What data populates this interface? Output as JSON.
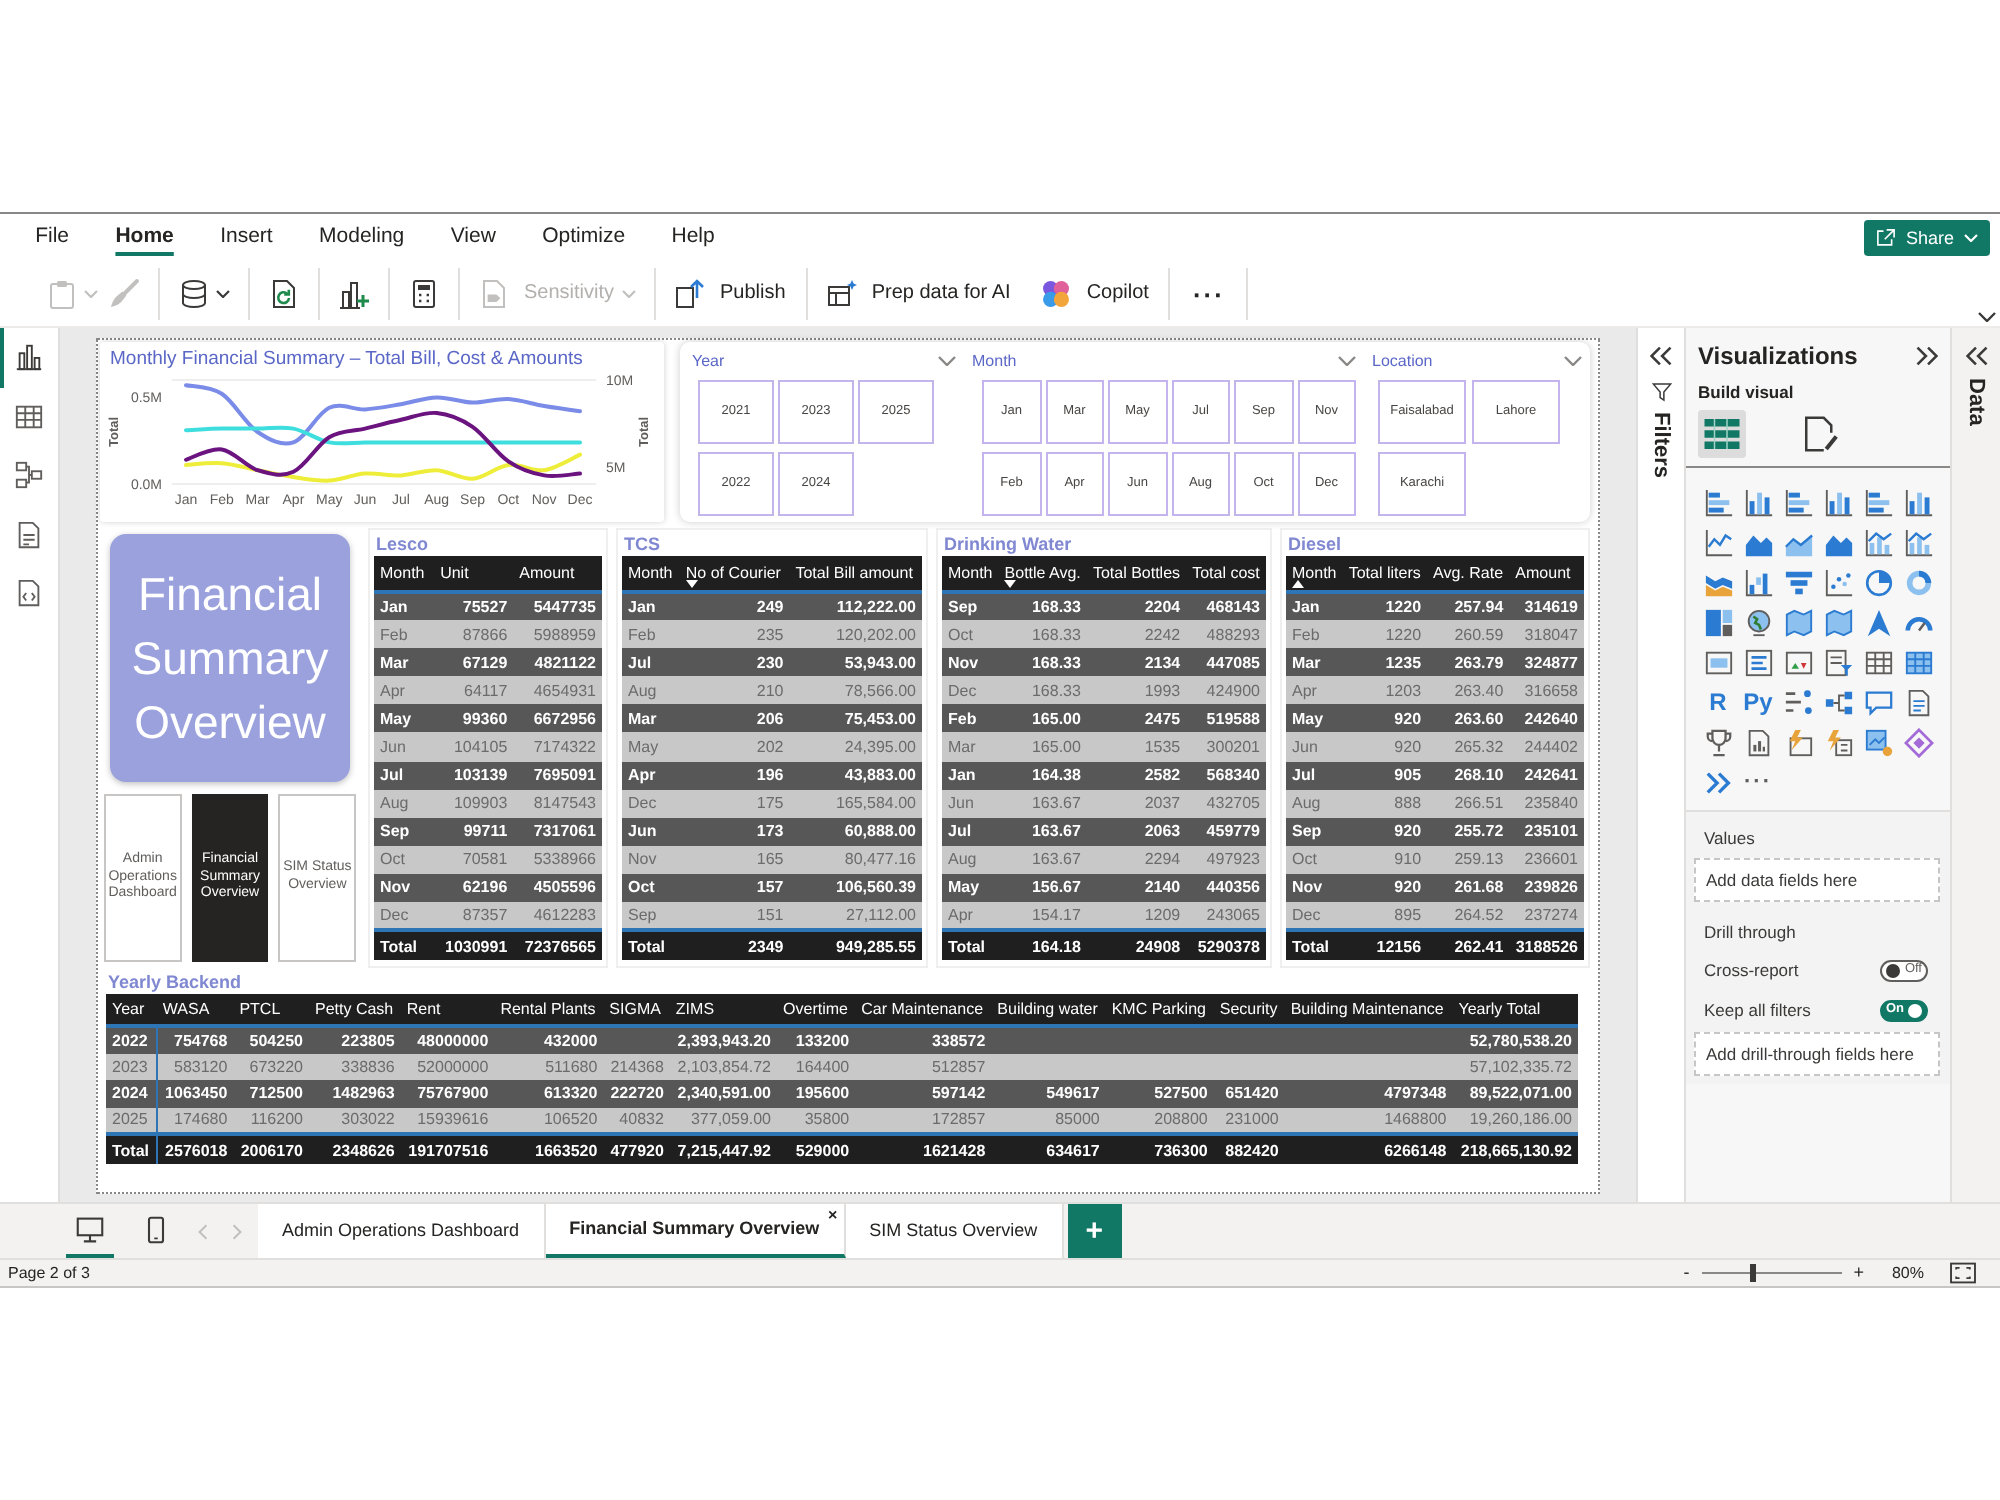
{
  "menu": {
    "tabs": [
      {
        "label": "File",
        "selected": false
      },
      {
        "label": "Home",
        "selected": true
      },
      {
        "label": "Insert",
        "selected": false
      },
      {
        "label": "Modeling",
        "selected": false
      },
      {
        "label": "View",
        "selected": false
      },
      {
        "label": "Optimize",
        "selected": false
      },
      {
        "label": "Help",
        "selected": false
      }
    ],
    "share": {
      "label": "Share"
    }
  },
  "ribbon": {
    "groups": [
      [
        {
          "kind": "paste",
          "disabled": true,
          "dropdown": true
        },
        {
          "kind": "format_painter",
          "disabled": true,
          "dropdown": false
        }
      ],
      [
        {
          "kind": "get_data",
          "disabled": false,
          "dropdown": true
        }
      ],
      [
        {
          "kind": "refresh",
          "disabled": false,
          "dropdown": false
        }
      ],
      [
        {
          "kind": "new_visual",
          "disabled": false,
          "dropdown": false
        }
      ],
      [
        {
          "kind": "calculator",
          "disabled": false,
          "dropdown": false
        }
      ],
      [
        {
          "kind": "sensitivity",
          "label": "Sensitivity",
          "disabled": true,
          "dropdown": true
        }
      ],
      [
        {
          "kind": "publish",
          "label": "Publish",
          "disabled": false,
          "dropdown": false
        }
      ],
      [
        {
          "kind": "prep_ai",
          "label": "Prep data for AI",
          "disabled": false,
          "dropdown": false
        },
        {
          "kind": "copilot",
          "label": "Copilot",
          "disabled": false,
          "dropdown": false
        }
      ],
      [
        {
          "kind": "more",
          "label": "···",
          "disabled": false,
          "dropdown": false
        }
      ]
    ]
  },
  "view_nav": [
    {
      "kind": "report",
      "selected": true
    },
    {
      "kind": "table",
      "selected": false
    },
    {
      "kind": "model",
      "selected": false
    },
    {
      "kind": "dax",
      "selected": false
    },
    {
      "kind": "tmdl",
      "selected": false
    }
  ],
  "report": {
    "chart": {
      "title": "Monthly Financial Summary – Total Bill, Cost & Amounts",
      "chart_data": {
        "type": "line",
        "categories": [
          "Jan",
          "Feb",
          "Mar",
          "Apr",
          "May",
          "Jun",
          "Jul",
          "Aug",
          "Sep",
          "Oct",
          "Nov",
          "Dec"
        ],
        "ylabel": "Total",
        "y2label": "Total",
        "ylim": [
          0,
          600000
        ],
        "yticks": [
          {
            "value": 0,
            "label": "0.0M"
          },
          {
            "value": 500000,
            "label": "0.5M"
          }
        ],
        "y2lim": [
          4000000,
          10000000
        ],
        "y2ticks": [
          {
            "value": 5000000,
            "label": "5M"
          },
          {
            "value": 10000000,
            "label": "10M"
          }
        ],
        "series": [
          {
            "color": "#7b8ce8",
            "values": [
              570000,
              520000,
              300000,
              240000,
              440000,
              430000,
              460000,
              500000,
              470000,
              490000,
              450000,
              420000
            ]
          },
          {
            "color": "#3fdede",
            "values": [
              310000,
              320000,
              320000,
              320000,
              240000,
              240000,
              240000,
              240000,
              240000,
              240000,
              240000,
              240000
            ]
          },
          {
            "color": "#eeee3a",
            "values": [
              110000,
              120000,
              80000,
              40000,
              20000,
              60000,
              50000,
              80000,
              30000,
              110000,
              80000,
              170000
            ]
          },
          {
            "color": "#6b1480",
            "axis": "y2",
            "values": [
              5400000,
              6000000,
              4800000,
              4700000,
              6700000,
              7200000,
              7700000,
              8100000,
              7300000,
              5300000,
              4500000,
              4600000
            ]
          }
        ]
      }
    },
    "slicers": [
      {
        "title": "Year",
        "items": [
          {
            "label": "2021",
            "selected": false
          },
          {
            "label": "2022",
            "selected": false
          },
          {
            "label": "2023",
            "selected": false
          },
          {
            "label": "2024",
            "selected": false
          },
          {
            "label": "2025",
            "selected": false
          }
        ]
      },
      {
        "title": "Month",
        "items": [
          {
            "label": "Jan",
            "selected": false
          },
          {
            "label": "Feb",
            "selected": false
          },
          {
            "label": "Mar",
            "selected": false
          },
          {
            "label": "Apr",
            "selected": false
          },
          {
            "label": "May",
            "selected": false
          },
          {
            "label": "Jun",
            "selected": false
          },
          {
            "label": "Jul",
            "selected": false
          },
          {
            "label": "Aug",
            "selected": false
          },
          {
            "label": "Sep",
            "selected": false
          },
          {
            "label": "Oct",
            "selected": false
          },
          {
            "label": "Nov",
            "selected": false
          },
          {
            "label": "Dec",
            "selected": false
          }
        ]
      },
      {
        "title": "Location",
        "items": [
          {
            "label": "Faisalabad",
            "selected": false
          },
          {
            "label": "Karachi",
            "selected": false
          },
          {
            "label": "Lahore",
            "selected": false
          }
        ]
      }
    ],
    "title_card": "Financial Summary Overview",
    "nav_buttons": [
      {
        "label": "Admin Operations Dashboard",
        "selected": false
      },
      {
        "label": "Financial Summary Overview",
        "selected": true
      },
      {
        "label": "SIM Status Overview",
        "selected": false
      }
    ],
    "tables": [
      {
        "title": "Lesco",
        "columns": [
          {
            "label": "Month",
            "kind": "plain"
          },
          {
            "label": "Unit",
            "kind": "plain"
          },
          {
            "label": "Amount",
            "kind": "plain"
          }
        ],
        "rows": [
          [
            "Jan",
            "75527",
            "5447735"
          ],
          [
            "Feb",
            "87866",
            "5988959"
          ],
          [
            "Mar",
            "67129",
            "4821122"
          ],
          [
            "Apr",
            "64117",
            "4654931"
          ],
          [
            "May",
            "99360",
            "6672956"
          ],
          [
            "Jun",
            "104105",
            "7174322"
          ],
          [
            "Jul",
            "103139",
            "7695091"
          ],
          [
            "Aug",
            "109903",
            "8147543"
          ],
          [
            "Sep",
            "99711",
            "7317061"
          ],
          [
            "Oct",
            "70581",
            "5338966"
          ],
          [
            "Nov",
            "62196",
            "4505596"
          ],
          [
            "Dec",
            "87357",
            "4612283"
          ]
        ],
        "total": [
          "Total",
          "1030991",
          "72376565"
        ]
      },
      {
        "title": "TCS",
        "columns": [
          {
            "label": "Month",
            "kind": "plain"
          },
          {
            "label": "No of Courier",
            "kind": "sorted_desc"
          },
          {
            "label": "Total Bill amount",
            "kind": "plain"
          }
        ],
        "rows": [
          [
            "Jan",
            "249",
            "112,222.00"
          ],
          [
            "Feb",
            "235",
            "120,202.00"
          ],
          [
            "Jul",
            "230",
            "53,943.00"
          ],
          [
            "Aug",
            "210",
            "78,566.00"
          ],
          [
            "Mar",
            "206",
            "75,453.00"
          ],
          [
            "May",
            "202",
            "24,395.00"
          ],
          [
            "Apr",
            "196",
            "43,883.00"
          ],
          [
            "Dec",
            "175",
            "165,584.00"
          ],
          [
            "Jun",
            "173",
            "60,888.00"
          ],
          [
            "Nov",
            "165",
            "80,477.16"
          ],
          [
            "Oct",
            "157",
            "106,560.39"
          ],
          [
            "Sep",
            "151",
            "27,112.00"
          ]
        ],
        "total": [
          "Total",
          "2349",
          "949,285.55"
        ]
      },
      {
        "title": "Drinking Water",
        "columns": [
          {
            "label": "Month",
            "kind": "plain"
          },
          {
            "label": "Bottle Avg.",
            "kind": "sorted_desc"
          },
          {
            "label": "Total Bottles",
            "kind": "plain"
          },
          {
            "label": "Total cost",
            "kind": "plain"
          }
        ],
        "rows": [
          [
            "Sep",
            "168.33",
            "2204",
            "468143"
          ],
          [
            "Oct",
            "168.33",
            "2242",
            "488293"
          ],
          [
            "Nov",
            "168.33",
            "2134",
            "447085"
          ],
          [
            "Dec",
            "168.33",
            "1993",
            "424900"
          ],
          [
            "Feb",
            "165.00",
            "2475",
            "519588"
          ],
          [
            "Mar",
            "165.00",
            "1535",
            "300201"
          ],
          [
            "Jan",
            "164.38",
            "2582",
            "568340"
          ],
          [
            "Jun",
            "163.67",
            "2037",
            "432705"
          ],
          [
            "Jul",
            "163.67",
            "2063",
            "459779"
          ],
          [
            "Aug",
            "163.67",
            "2294",
            "497923"
          ],
          [
            "May",
            "156.67",
            "2140",
            "440356"
          ],
          [
            "Apr",
            "154.17",
            "1209",
            "243065"
          ]
        ],
        "total": [
          "Total",
          "164.18",
          "24908",
          "5290378"
        ]
      },
      {
        "title": "Diesel",
        "columns": [
          {
            "label": "Month",
            "kind": "sorted_asc"
          },
          {
            "label": "Total liters",
            "kind": "plain"
          },
          {
            "label": "Avg. Rate",
            "kind": "plain"
          },
          {
            "label": "Amount",
            "kind": "plain"
          }
        ],
        "rows": [
          [
            "Jan",
            "1220",
            "257.94",
            "314619"
          ],
          [
            "Feb",
            "1220",
            "260.59",
            "318047"
          ],
          [
            "Mar",
            "1235",
            "263.79",
            "324877"
          ],
          [
            "Apr",
            "1203",
            "263.40",
            "316658"
          ],
          [
            "May",
            "920",
            "263.60",
            "242640"
          ],
          [
            "Jun",
            "920",
            "265.32",
            "244402"
          ],
          [
            "Jul",
            "905",
            "268.10",
            "242641"
          ],
          [
            "Aug",
            "888",
            "266.51",
            "235840"
          ],
          [
            "Sep",
            "920",
            "255.72",
            "235101"
          ],
          [
            "Oct",
            "910",
            "259.13",
            "236601"
          ],
          [
            "Nov",
            "920",
            "261.68",
            "239826"
          ],
          [
            "Dec",
            "895",
            "264.52",
            "237274"
          ]
        ],
        "total": [
          "Total",
          "12156",
          "262.41",
          "3188526"
        ]
      }
    ],
    "yearly_backend": {
      "title": "Yearly Backend",
      "columns": [
        {
          "label": "Year"
        },
        {
          "label": "WASA"
        },
        {
          "label": "PTCL"
        },
        {
          "label": "Petty Cash"
        },
        {
          "label": "Rent"
        },
        {
          "label": "Rental Plants"
        },
        {
          "label": "SIGMA"
        },
        {
          "label": "ZIMS"
        },
        {
          "label": "Overtime"
        },
        {
          "label": "Car Maintenance"
        },
        {
          "label": "Building water"
        },
        {
          "label": "KMC Parking"
        },
        {
          "label": "Security"
        },
        {
          "label": "Building Maintenance"
        },
        {
          "label": "Yearly Total"
        }
      ],
      "rows": [
        [
          "2022",
          "754768",
          "504250",
          "223805",
          "48000000",
          "432000",
          null,
          "2,393,943.20",
          "133200",
          "338572",
          null,
          null,
          null,
          null,
          "52,780,538.20"
        ],
        [
          "2023",
          "583120",
          "673220",
          "338836",
          "52000000",
          "511680",
          "214368",
          "2,103,854.72",
          "164400",
          "512857",
          null,
          null,
          null,
          null,
          "57,102,335.72"
        ],
        [
          "2024",
          "1063450",
          "712500",
          "1482963",
          "75767900",
          "613320",
          "222720",
          "2,340,591.00",
          "195600",
          "597142",
          "549617",
          "527500",
          "651420",
          "4797348",
          "89,522,071.00"
        ],
        [
          "2025",
          "174680",
          "116200",
          "303022",
          "15939616",
          "106520",
          "40832",
          "377,059.00",
          "35800",
          "172857",
          "85000",
          "208800",
          "231000",
          "1468800",
          "19,260,186.00"
        ]
      ],
      "total": [
        "Total",
        "2576018",
        "2006170",
        "2348626",
        "191707516",
        "1663520",
        "477920",
        "7,215,447.92",
        "529000",
        "1621428",
        "634617",
        "736300",
        "882420",
        "6266148",
        "218,665,130.92"
      ]
    }
  },
  "filters_pane": {
    "label": "Filters"
  },
  "visualizations": {
    "title": "Visualizations",
    "section": "Build visual",
    "modes": [
      {
        "kind": "build",
        "selected": true
      },
      {
        "kind": "format",
        "selected": false
      }
    ],
    "gallery": [
      {
        "kind": "hbar"
      },
      {
        "kind": "col"
      },
      {
        "kind": "hbar"
      },
      {
        "kind": "col"
      },
      {
        "kind": "hbar"
      },
      {
        "kind": "col"
      },
      {
        "kind": "line"
      },
      {
        "kind": "area"
      },
      {
        "kind": "area_line"
      },
      {
        "kind": "area"
      },
      {
        "kind": "combo"
      },
      {
        "kind": "combo"
      },
      {
        "kind": "ribbon"
      },
      {
        "kind": "waterfall"
      },
      {
        "kind": "funnel"
      },
      {
        "kind": "scatter"
      },
      {
        "kind": "pie"
      },
      {
        "kind": "donut"
      },
      {
        "kind": "treemap"
      },
      {
        "kind": "globe"
      },
      {
        "kind": "map"
      },
      {
        "kind": "map"
      },
      {
        "kind": "arrow"
      },
      {
        "kind": "gauge"
      },
      {
        "kind": "card"
      },
      {
        "kind": "list"
      },
      {
        "kind": "kpi"
      },
      {
        "kind": "slicer"
      },
      {
        "kind": "table"
      },
      {
        "kind": "matrix"
      },
      {
        "kind": "r_script",
        "glyph": "R"
      },
      {
        "kind": "python",
        "glyph": "Py"
      },
      {
        "kind": "influencers"
      },
      {
        "kind": "decomp"
      },
      {
        "kind": "qa"
      },
      {
        "kind": "narrative"
      },
      {
        "kind": "trophy"
      },
      {
        "kind": "paginated"
      },
      {
        "kind": "apps"
      },
      {
        "kind": "automate"
      },
      {
        "kind": "badge"
      },
      {
        "kind": "diamond"
      },
      {
        "kind": "chevrons"
      },
      {
        "kind": "more",
        "glyph": "···"
      }
    ],
    "values": {
      "title": "Values",
      "drop_zone": "Add data fields here"
    },
    "drill_through": {
      "title": "Drill through",
      "toggles": [
        {
          "label": "Cross-report",
          "on": false,
          "state_label": "Off"
        },
        {
          "label": "Keep all filters",
          "on": true,
          "state_label": "On"
        }
      ],
      "drop_zone": "Add drill-through fields here"
    }
  },
  "data_pane": {
    "label": "Data"
  },
  "page_tabs": {
    "layouts": [
      {
        "kind": "desktop",
        "selected": true
      },
      {
        "kind": "mobile",
        "selected": false
      }
    ],
    "arrows": [
      {
        "kind": "prev",
        "disabled": true
      },
      {
        "kind": "next",
        "disabled": true
      }
    ],
    "tabs": [
      {
        "label": "Admin Operations Dashboard",
        "selected": false
      },
      {
        "label": "Financial Summary Overview",
        "selected": true,
        "close": "×"
      },
      {
        "label": "SIM Status Overview",
        "selected": false
      }
    ],
    "add": "+"
  },
  "status_bar": {
    "page": "Page 2 of 3",
    "zoom": {
      "minus": "-",
      "plus": "+",
      "level": 0.36,
      "reading": "80%"
    }
  }
}
